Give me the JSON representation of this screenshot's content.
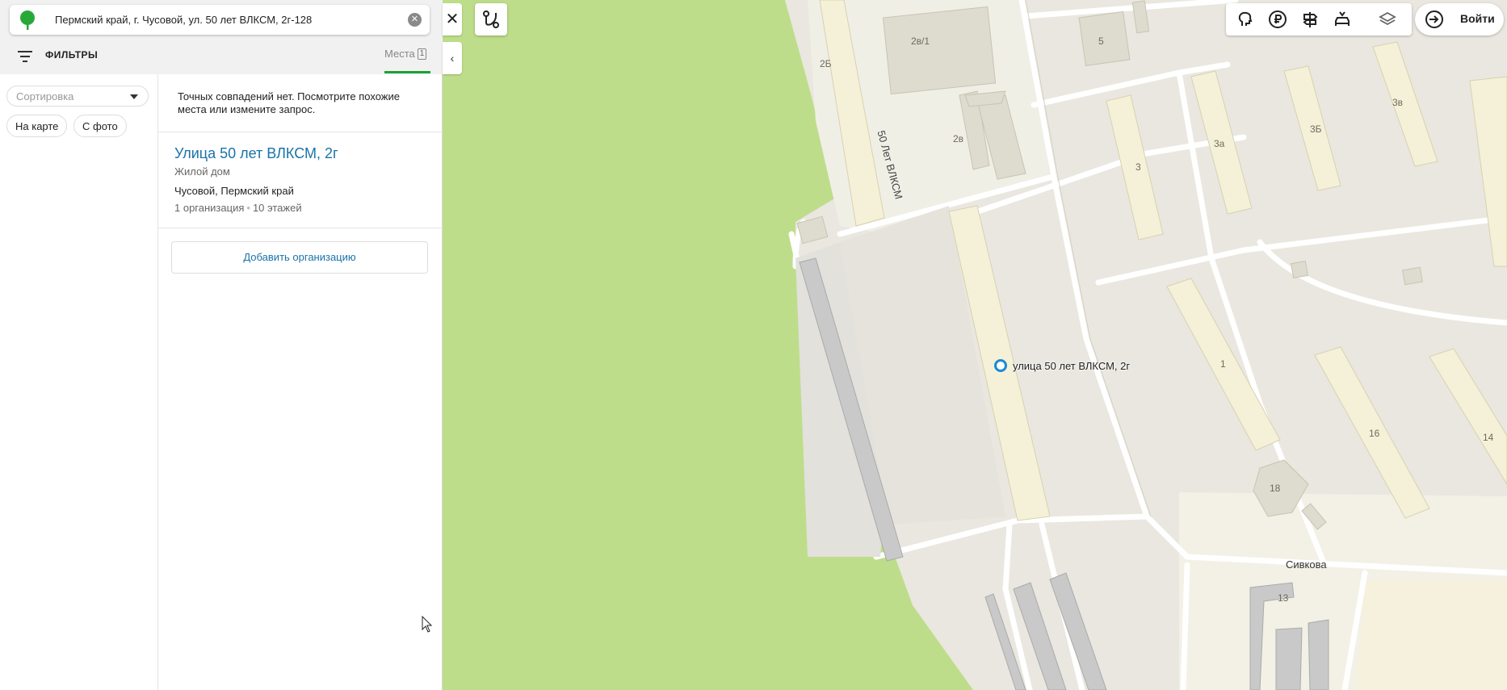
{
  "search": {
    "value": "Пермский край, г. Чусовой, ул. 50 лет ВЛКСМ, 2г-128",
    "clear_icon": "close-circle-icon"
  },
  "filters": {
    "label": "ФИЛЬТРЫ",
    "places_tab": "Места",
    "places_count": "1"
  },
  "sort": {
    "placeholder": "Сортировка",
    "chips": [
      "На карте",
      "С фото"
    ]
  },
  "results": {
    "no_match": "Точных совпадений нет. Посмотрите похожие места или измените запрос.",
    "item": {
      "title": "Улица 50 лет ВЛКСМ, 2г",
      "type": "Жилой дом",
      "address": "Чусовой, Пермский край",
      "orgs": "1 организация",
      "floors": "10 этажей"
    },
    "add_org": "Добавить организацию"
  },
  "controls": {
    "close": "✕",
    "collapse": "‹",
    "login": "Войти"
  },
  "map": {
    "marker_label": "улица 50 лет ВЛКСМ, 2г",
    "streets": {
      "vlksm": "50 Лет ВЛКСМ",
      "sivkova": "Сивкова"
    },
    "buildings": [
      "2Б",
      "2в/1",
      "5",
      "2в",
      "3",
      "3а",
      "3Б",
      "3в",
      "1",
      "16",
      "14",
      "18",
      "13"
    ]
  },
  "colors": {
    "accent_green": "#1ba136",
    "link_blue": "#1a73a8",
    "park_green": "#bedd8a",
    "map_bg": "#e9e7df"
  }
}
